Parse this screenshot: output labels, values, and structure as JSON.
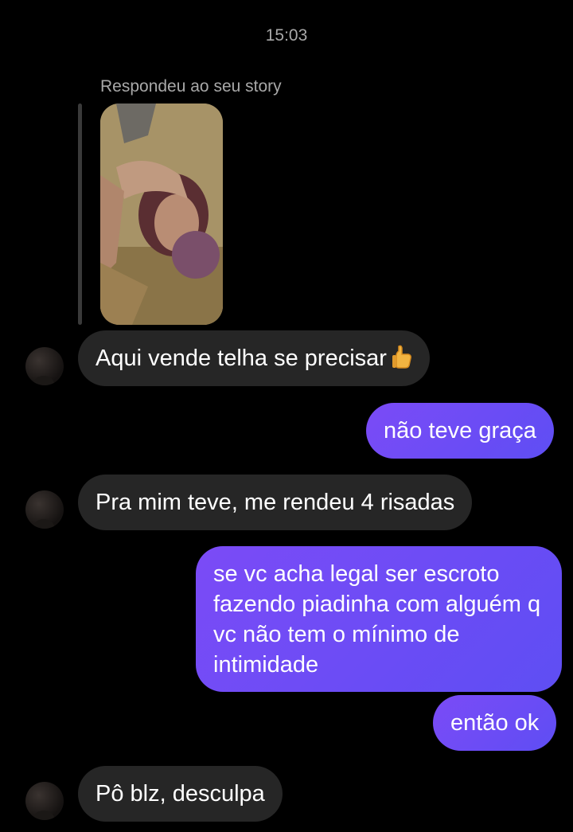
{
  "conversation": {
    "timestamp": "15:03",
    "reply_caption": "Respondeu ao seu story",
    "messages": [
      {
        "from": "them",
        "text": "Aqui vende telha se precisar"
      },
      {
        "from": "me",
        "text": "não teve graça"
      },
      {
        "from": "them",
        "text": "Pra mim teve, me rendeu 4 risadas"
      },
      {
        "from": "me",
        "text": "se vc acha legal ser escroto fazendo piadinha com alguém q vc não tem o mínimo de intimidade"
      },
      {
        "from": "me",
        "text": "então ok"
      },
      {
        "from": "them",
        "text": "Pô blz, desculpa"
      }
    ]
  },
  "icons": {
    "thumbs_up": "thumbs-up-emoji",
    "avatar": "contact-avatar"
  },
  "colors": {
    "background": "#000000",
    "incoming_bubble": "#262626",
    "outgoing_bubble": "#6a4cf5",
    "meta_text": "#a8a8a8"
  }
}
